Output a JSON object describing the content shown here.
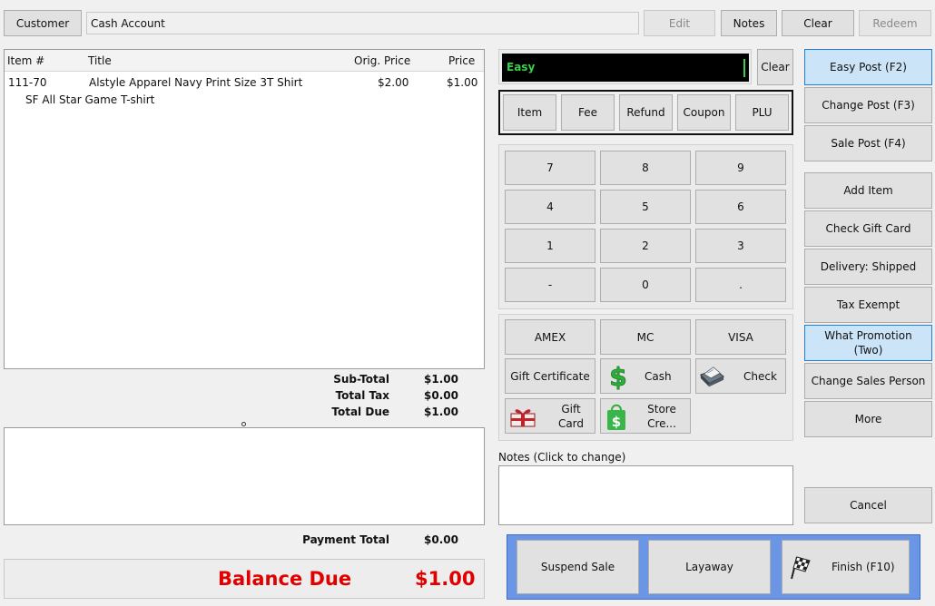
{
  "top_bar": {
    "customer_label": "Customer",
    "account_value": "Cash Account",
    "edit_label": "Edit",
    "notes_label": "Notes",
    "clear_label": "Clear",
    "redeem_label": "Redeem"
  },
  "items_table": {
    "columns": [
      "Item #",
      "Title",
      "Orig. Price",
      "Price"
    ],
    "rows": [
      {
        "item_no": "111-70",
        "title": "Alstyle Apparel Navy Print Size 3T Shirt",
        "orig_price": "$2.00",
        "price": "$1.00",
        "subtitle": "SF All Star Game T-shirt"
      }
    ]
  },
  "totals": {
    "subtotal_label": "Sub-Total",
    "subtotal_value": "$1.00",
    "tax_label": "Total Tax",
    "tax_value": "$0.00",
    "due_label": "Total Due",
    "due_value": "$1.00"
  },
  "payment": {
    "total_label": "Payment Total",
    "total_value": "$0.00",
    "balance_label": "Balance Due",
    "balance_value": "$1.00"
  },
  "entry": {
    "mode_text": "Easy",
    "clear_label": "Clear",
    "modes": [
      "Item",
      "Fee",
      "Refund",
      "Coupon",
      "PLU"
    ]
  },
  "keypad": [
    "7",
    "8",
    "9",
    "4",
    "5",
    "6",
    "1",
    "2",
    "3",
    "-",
    "0",
    "."
  ],
  "tenders": {
    "amex": "AMEX",
    "mc": "MC",
    "visa": "VISA",
    "gift_certificate": "Gift Certificate",
    "cash": "Cash",
    "check": "Check",
    "gift_card": "Gift Card",
    "store_credit": "Store Cre..."
  },
  "notes": {
    "label": "Notes (Click to change)"
  },
  "side_buttons": {
    "easy_post": "Easy Post (F2)",
    "change_post": "Change Post (F3)",
    "sale_post": "Sale Post (F4)",
    "add_item": "Add Item",
    "check_gift_card": "Check Gift Card",
    "delivery": "Delivery: Shipped",
    "tax_exempt": "Tax Exempt",
    "what_promotion": "What Promotion",
    "what_promotion_sub": "(Two)",
    "change_sales_person": "Change Sales Person",
    "more": "More",
    "cancel": "Cancel"
  },
  "bottom_actions": {
    "suspend": "Suspend Sale",
    "layaway": "Layaway",
    "finish": "Finish (F10)"
  },
  "colors": {
    "accent_blue": "#6b96e6",
    "balance_red": "#e00000",
    "display_green": "#39d24a"
  }
}
